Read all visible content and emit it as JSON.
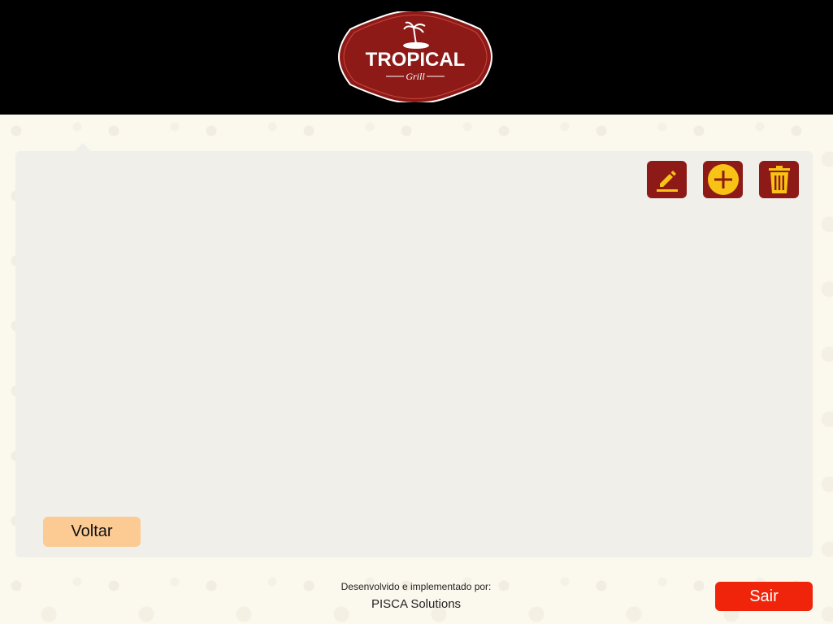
{
  "header": {
    "logo": {
      "brand": "TROPICAL",
      "subtitle": "Grill",
      "icon": "palm-island-icon"
    }
  },
  "toolbar": {
    "edit_icon": "pencil-icon",
    "add_icon": "plus-circle-icon",
    "delete_icon": "trash-icon"
  },
  "actions": {
    "back_label": "Voltar",
    "logout_label": "Sair"
  },
  "footer": {
    "credit_line": "Desenvolvido e implementado por:",
    "company": "PISCA Solutions"
  },
  "colors": {
    "header_bg": "#000000",
    "brand_red": "#8e1a17",
    "icon_yellow": "#f7c315",
    "panel_bg": "#f0efe9",
    "back_button": "#fccb93",
    "logout_button": "#f0240a"
  }
}
